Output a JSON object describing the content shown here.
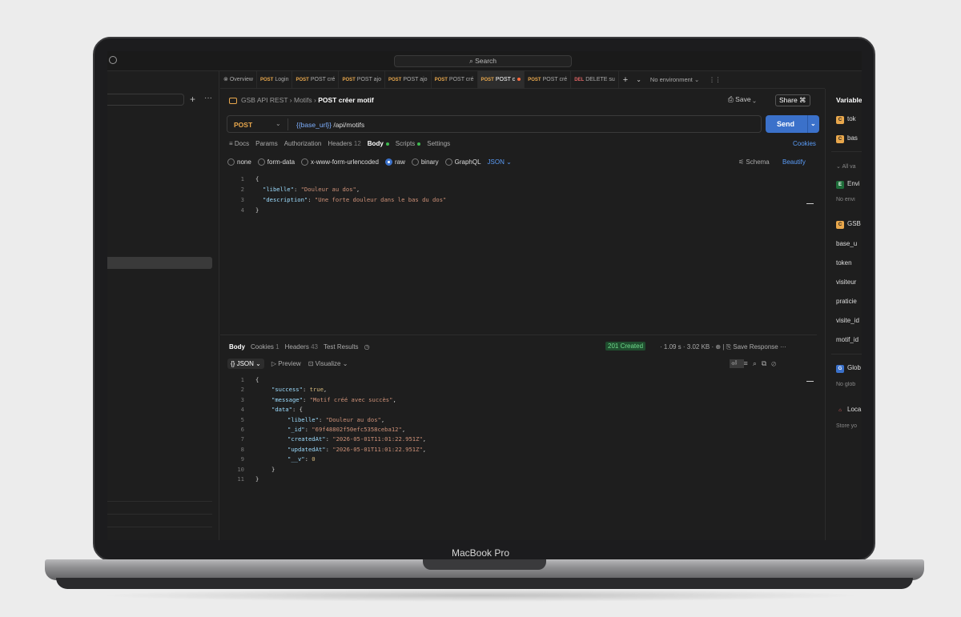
{
  "device_label": "MacBook Pro",
  "search": {
    "label": "Search"
  },
  "tabs": [
    {
      "method": "",
      "label": "Overview"
    },
    {
      "method": "POST",
      "label": "Login"
    },
    {
      "method": "POST",
      "label": "POST cré"
    },
    {
      "method": "POST",
      "label": "POST ajo"
    },
    {
      "method": "POST",
      "label": "POST ajo"
    },
    {
      "method": "POST",
      "label": "POST cré"
    },
    {
      "method": "POST",
      "label": "POST c"
    },
    {
      "method": "POST",
      "label": "POST cré"
    },
    {
      "method": "DEL",
      "label": "DELETE su"
    }
  ],
  "environment": "No environment",
  "breadcrumb": {
    "collection": "GSB API REST",
    "folder": "Motifs",
    "request": "POST créer motif"
  },
  "actions": {
    "save": "Save",
    "share": "Share",
    "send": "Send"
  },
  "request": {
    "method": "POST",
    "url_var": "{{base_url}}",
    "url_path": "/api/motifs"
  },
  "request_tabs": [
    "Docs",
    "Params",
    "Authorization",
    "Headers",
    "Body",
    "Scripts",
    "Settings"
  ],
  "headers_count": "12",
  "cookies_link": "Cookies",
  "body_options": [
    "none",
    "form-data",
    "x-www-form-urlencoded",
    "raw",
    "binary",
    "GraphQL"
  ],
  "body_format": "JSON",
  "schema_label": "Schema",
  "beautify_label": "Beautify",
  "request_body_lines": [
    {
      "n": "1",
      "code": "{"
    },
    {
      "n": "2",
      "key": "\"libelle\"",
      "val": "\"Douleur au dos\"",
      "end": ","
    },
    {
      "n": "3",
      "key": "\"description\"",
      "val": "\"Une forte douleur dans le bas du dos\"",
      "end": ""
    },
    {
      "n": "4",
      "code": "}"
    }
  ],
  "response_tabs": {
    "body": "Body",
    "cookies": "Cookies",
    "cookies_count": "1",
    "headers": "Headers",
    "headers_count": "43",
    "tests": "Test Results"
  },
  "response_status": "201 Created",
  "response_time": "1.09 s",
  "response_size": "3.02 KB",
  "save_response": "Save Response",
  "response_format": {
    "format": "JSON",
    "preview": "Preview",
    "visualize": "Visualize"
  },
  "response_body_lines": [
    {
      "n": "1",
      "indent": 0,
      "code": "{"
    },
    {
      "n": "2",
      "indent": 1,
      "key": "\"success\"",
      "val": "true",
      "end": ","
    },
    {
      "n": "3",
      "indent": 1,
      "key": "\"message\"",
      "val": "\"Motif créé avec succès\"",
      "end": ","
    },
    {
      "n": "4",
      "indent": 1,
      "key": "\"data\"",
      "val": "{",
      "end": ""
    },
    {
      "n": "5",
      "indent": 2,
      "key": "\"libelle\"",
      "val": "\"Douleur au dos\"",
      "end": ","
    },
    {
      "n": "6",
      "indent": 2,
      "key": "\"_id\"",
      "val": "\"69f48802f50efc5358ceba12\"",
      "end": ","
    },
    {
      "n": "7",
      "indent": 2,
      "key": "\"createdAt\"",
      "val": "\"2026-05-01T11:01:22.951Z\"",
      "end": ","
    },
    {
      "n": "8",
      "indent": 2,
      "key": "\"updatedAt\"",
      "val": "\"2026-05-01T11:01:22.951Z\"",
      "end": ","
    },
    {
      "n": "9",
      "indent": 2,
      "key": "\"__v\"",
      "val": "0",
      "end": ""
    },
    {
      "n": "10",
      "indent": 1,
      "code": "}"
    },
    {
      "n": "11",
      "indent": 0,
      "code": "}"
    }
  ],
  "variables_panel": {
    "title": "Variables",
    "collection_vars_short": [
      "tok",
      "bas"
    ],
    "all_label": "All va",
    "env_label": "Envi",
    "no_env": "No envi",
    "gsb_label": "GSB",
    "vars": [
      "base_u",
      "token",
      "visiteur",
      "praticie",
      "visite_id",
      "motif_id"
    ],
    "global_label": "Glob",
    "no_global": "No glob",
    "local_label": "Loca",
    "store_label": "Store yo"
  }
}
